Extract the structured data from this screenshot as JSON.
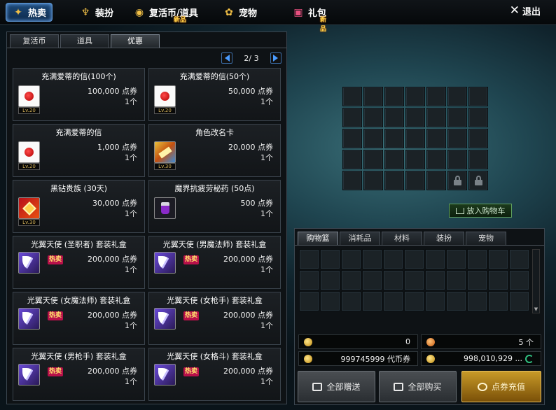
{
  "nav": {
    "items": [
      {
        "label": "热卖",
        "icon": "hot-sale-icon",
        "active": true
      },
      {
        "label": "装扮",
        "icon": "trophy-icon",
        "active": false
      },
      {
        "label": "复活币/道具",
        "icon": "revive-coin-icon",
        "badge": "新品",
        "active": false
      },
      {
        "label": "宠物",
        "icon": "paw-icon",
        "active": false
      },
      {
        "label": "礼包",
        "icon": "gift-icon",
        "badge": "新品",
        "active": false
      }
    ],
    "exit_label": "退出"
  },
  "left_tabs": [
    {
      "label": "复活币",
      "active": false
    },
    {
      "label": "道具",
      "active": false
    },
    {
      "label": "优惠",
      "active": true
    }
  ],
  "pager": {
    "text": "2/ 3"
  },
  "products": [
    {
      "title": "充满爱蒂的信(100个)",
      "price": "100,000 点券",
      "qty": "1个",
      "level": "Lv.20",
      "icon": "letter-icon"
    },
    {
      "title": "充满爱蒂的信(50个)",
      "price": "50,000 点券",
      "qty": "1个",
      "level": "Lv.20",
      "icon": "letter-icon"
    },
    {
      "title": "充满爱蒂的信",
      "price": "1,000 点券",
      "qty": "1个",
      "level": "Lv.20",
      "icon": "letter-icon"
    },
    {
      "title": "角色改名卡",
      "price": "20,000 点券",
      "qty": "1个",
      "level": "Lv.30",
      "icon": "rename-card-icon"
    },
    {
      "title": "黑钻贵族 (30天)",
      "price": "30,000 点券",
      "qty": "1个",
      "level": "Lv.30",
      "icon": "black-diamond-icon"
    },
    {
      "title": "魔界抗疲劳秘药 (50点)",
      "price": "500 点券",
      "qty": "1个",
      "icon": "potion-icon"
    },
    {
      "title": "光翼天使 (圣职者) 套装礼盒",
      "price": "200,000 点券",
      "qty": "1个",
      "hot": "热卖",
      "icon": "angel-wing-icon"
    },
    {
      "title": "光翼天使 (男魔法师) 套装礼盒",
      "price": "200,000 点券",
      "qty": "1个",
      "hot": "热卖",
      "icon": "angel-wing-icon"
    },
    {
      "title": "光翼天使 (女魔法师) 套装礼盒",
      "price": "200,000 点券",
      "qty": "1个",
      "hot": "热卖",
      "icon": "angel-wing-icon"
    },
    {
      "title": "光翼天使 (女枪手) 套装礼盒",
      "price": "200,000 点券",
      "qty": "1个",
      "hot": "热卖",
      "icon": "angel-wing-icon"
    },
    {
      "title": "光翼天使 (男枪手) 套装礼盒",
      "price": "200,000 点券",
      "qty": "1个",
      "hot": "热卖",
      "icon": "angel-wing-icon"
    },
    {
      "title": "光翼天使 (女格斗) 套装礼盒",
      "price": "200,000 点券",
      "qty": "1个",
      "hot": "热卖",
      "icon": "angel-wing-icon"
    }
  ],
  "add_to_cart_label": "放入购物车",
  "cart_tabs": [
    {
      "label": "购物篮",
      "active": true
    },
    {
      "label": "消耗品",
      "active": false
    },
    {
      "label": "材料",
      "active": false
    },
    {
      "label": "装扮",
      "active": false
    },
    {
      "label": "宠物",
      "active": false
    }
  ],
  "stats": {
    "cart_total": "0",
    "item_count": "5 个",
    "coupons": "999745999 代币券",
    "points": "998,010,929 ..."
  },
  "buttons": {
    "gift_all": "全部赠送",
    "buy_all": "全部购买",
    "recharge": "点券充值"
  },
  "colors": {
    "accent_blue": "#4a9cff",
    "hot_badge": "#b8104a",
    "recharge_gold": "#c89a28"
  }
}
